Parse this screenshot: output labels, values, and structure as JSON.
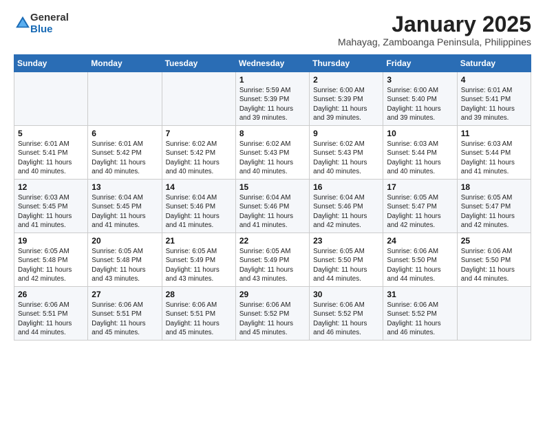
{
  "logo": {
    "general": "General",
    "blue": "Blue"
  },
  "title": "January 2025",
  "subtitle": "Mahayag, Zamboanga Peninsula, Philippines",
  "days_header": [
    "Sunday",
    "Monday",
    "Tuesday",
    "Wednesday",
    "Thursday",
    "Friday",
    "Saturday"
  ],
  "weeks": [
    [
      {
        "day": "",
        "sunrise": "",
        "sunset": "",
        "daylight": ""
      },
      {
        "day": "",
        "sunrise": "",
        "sunset": "",
        "daylight": ""
      },
      {
        "day": "",
        "sunrise": "",
        "sunset": "",
        "daylight": ""
      },
      {
        "day": "1",
        "sunrise": "Sunrise: 5:59 AM",
        "sunset": "Sunset: 5:39 PM",
        "daylight": "Daylight: 11 hours and 39 minutes."
      },
      {
        "day": "2",
        "sunrise": "Sunrise: 6:00 AM",
        "sunset": "Sunset: 5:39 PM",
        "daylight": "Daylight: 11 hours and 39 minutes."
      },
      {
        "day": "3",
        "sunrise": "Sunrise: 6:00 AM",
        "sunset": "Sunset: 5:40 PM",
        "daylight": "Daylight: 11 hours and 39 minutes."
      },
      {
        "day": "4",
        "sunrise": "Sunrise: 6:01 AM",
        "sunset": "Sunset: 5:41 PM",
        "daylight": "Daylight: 11 hours and 39 minutes."
      }
    ],
    [
      {
        "day": "5",
        "sunrise": "Sunrise: 6:01 AM",
        "sunset": "Sunset: 5:41 PM",
        "daylight": "Daylight: 11 hours and 40 minutes."
      },
      {
        "day": "6",
        "sunrise": "Sunrise: 6:01 AM",
        "sunset": "Sunset: 5:42 PM",
        "daylight": "Daylight: 11 hours and 40 minutes."
      },
      {
        "day": "7",
        "sunrise": "Sunrise: 6:02 AM",
        "sunset": "Sunset: 5:42 PM",
        "daylight": "Daylight: 11 hours and 40 minutes."
      },
      {
        "day": "8",
        "sunrise": "Sunrise: 6:02 AM",
        "sunset": "Sunset: 5:43 PM",
        "daylight": "Daylight: 11 hours and 40 minutes."
      },
      {
        "day": "9",
        "sunrise": "Sunrise: 6:02 AM",
        "sunset": "Sunset: 5:43 PM",
        "daylight": "Daylight: 11 hours and 40 minutes."
      },
      {
        "day": "10",
        "sunrise": "Sunrise: 6:03 AM",
        "sunset": "Sunset: 5:44 PM",
        "daylight": "Daylight: 11 hours and 40 minutes."
      },
      {
        "day": "11",
        "sunrise": "Sunrise: 6:03 AM",
        "sunset": "Sunset: 5:44 PM",
        "daylight": "Daylight: 11 hours and 41 minutes."
      }
    ],
    [
      {
        "day": "12",
        "sunrise": "Sunrise: 6:03 AM",
        "sunset": "Sunset: 5:45 PM",
        "daylight": "Daylight: 11 hours and 41 minutes."
      },
      {
        "day": "13",
        "sunrise": "Sunrise: 6:04 AM",
        "sunset": "Sunset: 5:45 PM",
        "daylight": "Daylight: 11 hours and 41 minutes."
      },
      {
        "day": "14",
        "sunrise": "Sunrise: 6:04 AM",
        "sunset": "Sunset: 5:46 PM",
        "daylight": "Daylight: 11 hours and 41 minutes."
      },
      {
        "day": "15",
        "sunrise": "Sunrise: 6:04 AM",
        "sunset": "Sunset: 5:46 PM",
        "daylight": "Daylight: 11 hours and 41 minutes."
      },
      {
        "day": "16",
        "sunrise": "Sunrise: 6:04 AM",
        "sunset": "Sunset: 5:46 PM",
        "daylight": "Daylight: 11 hours and 42 minutes."
      },
      {
        "day": "17",
        "sunrise": "Sunrise: 6:05 AM",
        "sunset": "Sunset: 5:47 PM",
        "daylight": "Daylight: 11 hours and 42 minutes."
      },
      {
        "day": "18",
        "sunrise": "Sunrise: 6:05 AM",
        "sunset": "Sunset: 5:47 PM",
        "daylight": "Daylight: 11 hours and 42 minutes."
      }
    ],
    [
      {
        "day": "19",
        "sunrise": "Sunrise: 6:05 AM",
        "sunset": "Sunset: 5:48 PM",
        "daylight": "Daylight: 11 hours and 42 minutes."
      },
      {
        "day": "20",
        "sunrise": "Sunrise: 6:05 AM",
        "sunset": "Sunset: 5:48 PM",
        "daylight": "Daylight: 11 hours and 43 minutes."
      },
      {
        "day": "21",
        "sunrise": "Sunrise: 6:05 AM",
        "sunset": "Sunset: 5:49 PM",
        "daylight": "Daylight: 11 hours and 43 minutes."
      },
      {
        "day": "22",
        "sunrise": "Sunrise: 6:05 AM",
        "sunset": "Sunset: 5:49 PM",
        "daylight": "Daylight: 11 hours and 43 minutes."
      },
      {
        "day": "23",
        "sunrise": "Sunrise: 6:05 AM",
        "sunset": "Sunset: 5:50 PM",
        "daylight": "Daylight: 11 hours and 44 minutes."
      },
      {
        "day": "24",
        "sunrise": "Sunrise: 6:06 AM",
        "sunset": "Sunset: 5:50 PM",
        "daylight": "Daylight: 11 hours and 44 minutes."
      },
      {
        "day": "25",
        "sunrise": "Sunrise: 6:06 AM",
        "sunset": "Sunset: 5:50 PM",
        "daylight": "Daylight: 11 hours and 44 minutes."
      }
    ],
    [
      {
        "day": "26",
        "sunrise": "Sunrise: 6:06 AM",
        "sunset": "Sunset: 5:51 PM",
        "daylight": "Daylight: 11 hours and 44 minutes."
      },
      {
        "day": "27",
        "sunrise": "Sunrise: 6:06 AM",
        "sunset": "Sunset: 5:51 PM",
        "daylight": "Daylight: 11 hours and 45 minutes."
      },
      {
        "day": "28",
        "sunrise": "Sunrise: 6:06 AM",
        "sunset": "Sunset: 5:51 PM",
        "daylight": "Daylight: 11 hours and 45 minutes."
      },
      {
        "day": "29",
        "sunrise": "Sunrise: 6:06 AM",
        "sunset": "Sunset: 5:52 PM",
        "daylight": "Daylight: 11 hours and 45 minutes."
      },
      {
        "day": "30",
        "sunrise": "Sunrise: 6:06 AM",
        "sunset": "Sunset: 5:52 PM",
        "daylight": "Daylight: 11 hours and 46 minutes."
      },
      {
        "day": "31",
        "sunrise": "Sunrise: 6:06 AM",
        "sunset": "Sunset: 5:52 PM",
        "daylight": "Daylight: 11 hours and 46 minutes."
      },
      {
        "day": "",
        "sunrise": "",
        "sunset": "",
        "daylight": ""
      }
    ]
  ]
}
